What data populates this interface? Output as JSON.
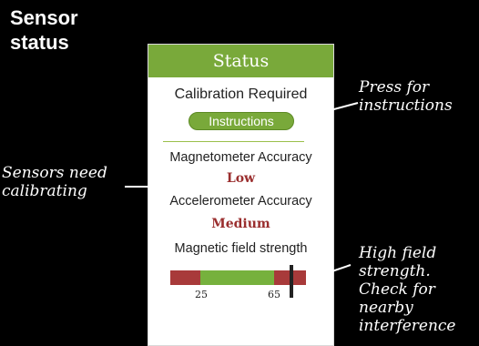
{
  "page": {
    "title": "Sensor status"
  },
  "panel": {
    "header": "Status",
    "calibration_status": "Calibration Required",
    "instructions_button": "Instructions",
    "magnetometer": {
      "label": "Magnetometer Accuracy",
      "value": "Low"
    },
    "accelerometer": {
      "label": "Accelerometer Accuracy",
      "value": "Medium"
    },
    "field_strength": {
      "label": "Magnetic field strength",
      "tick_low": "25",
      "tick_high": "65",
      "colors": {
        "low": "#a83a3a",
        "ok": "#76b13d",
        "high": "#a83a3a"
      }
    }
  },
  "annotations": {
    "press": "Press for instructions",
    "sensors": "Sensors need calibrating",
    "high_field": "High field strength. Check for nearby interference"
  },
  "colors": {
    "accent": "#79a93a",
    "warning_text": "#9a2e2e",
    "background": "#000000"
  }
}
